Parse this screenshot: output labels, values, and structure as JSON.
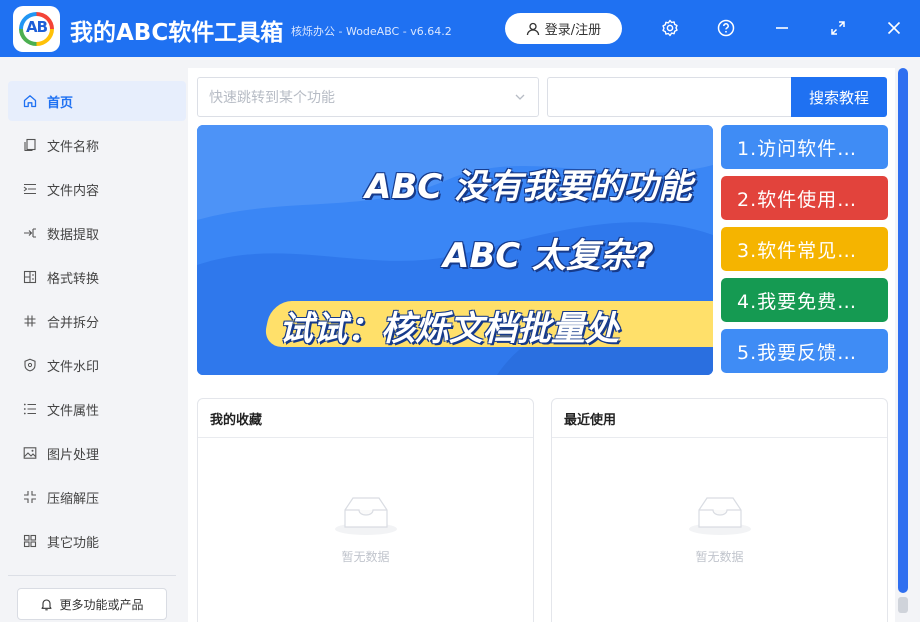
{
  "header": {
    "logo_text": "AB",
    "title": "我的ABC软件工具箱",
    "subtitle": "核烁办公 - WodeABC - v6.64.2",
    "login_label": "登录/注册",
    "icons": [
      "settings-icon",
      "help-icon",
      "minimize-icon",
      "maximize-icon",
      "close-icon"
    ]
  },
  "sidebar": {
    "items": [
      {
        "label": "首页",
        "icon": "home-icon",
        "active": true
      },
      {
        "label": "文件名称",
        "icon": "file-copy-icon"
      },
      {
        "label": "文件内容",
        "icon": "indent-list-icon"
      },
      {
        "label": "数据提取",
        "icon": "extract-icon"
      },
      {
        "label": "格式转换",
        "icon": "convert-icon"
      },
      {
        "label": "合并拆分",
        "icon": "hash-icon"
      },
      {
        "label": "文件水印",
        "icon": "shield-icon"
      },
      {
        "label": "文件属性",
        "icon": "list-icon"
      },
      {
        "label": "图片处理",
        "icon": "image-icon"
      },
      {
        "label": "压缩解压",
        "icon": "compress-icon"
      },
      {
        "label": "其它功能",
        "icon": "grid-icon"
      }
    ],
    "more_label": "更多功能或产品"
  },
  "search": {
    "jump_placeholder": "快速跳转到某个功能",
    "search_value": "",
    "search_button": "搜索教程"
  },
  "banner": {
    "line1": "ABC 没有我要的功能",
    "line2": "ABC 太复杂?",
    "line3": "试试：核烁文档批量处"
  },
  "quick_links": [
    {
      "label": "1.访问软件…",
      "color": "#3f8cf5"
    },
    {
      "label": "2.软件使用…",
      "color": "#e2433c"
    },
    {
      "label": "3.软件常见…",
      "color": "#f5b400"
    },
    {
      "label": "4.我要免费…",
      "color": "#159a52"
    },
    {
      "label": "5.我要反馈…",
      "color": "#3f8cf5"
    }
  ],
  "favorites": {
    "title": "我的收藏",
    "empty_text": "暂无数据"
  },
  "recent": {
    "title": "最近使用",
    "empty_text": "暂无数据"
  }
}
